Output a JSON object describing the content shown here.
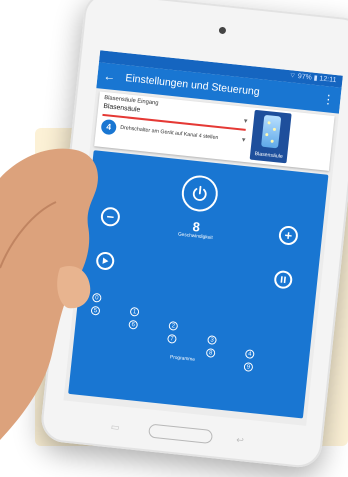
{
  "status": {
    "battery": "97%",
    "time": "12:11"
  },
  "appbar": {
    "title": "Einstellungen und Steuerung"
  },
  "control": {
    "dropdown_label": "Blasensäule Eingang",
    "dropdown_value": "Blasensäule",
    "channel_number": "4",
    "hint": "Drehschalter am Gerät auf Kanal 4 stellen",
    "device_name": "Blasensäule"
  },
  "remote": {
    "speed_value": "8",
    "speed_label": "Geschwindigkeit",
    "programs_label": "Programme",
    "programs": [
      "0",
      "1",
      "2",
      "3",
      "4",
      "5",
      "6",
      "7",
      "8",
      "9"
    ]
  }
}
